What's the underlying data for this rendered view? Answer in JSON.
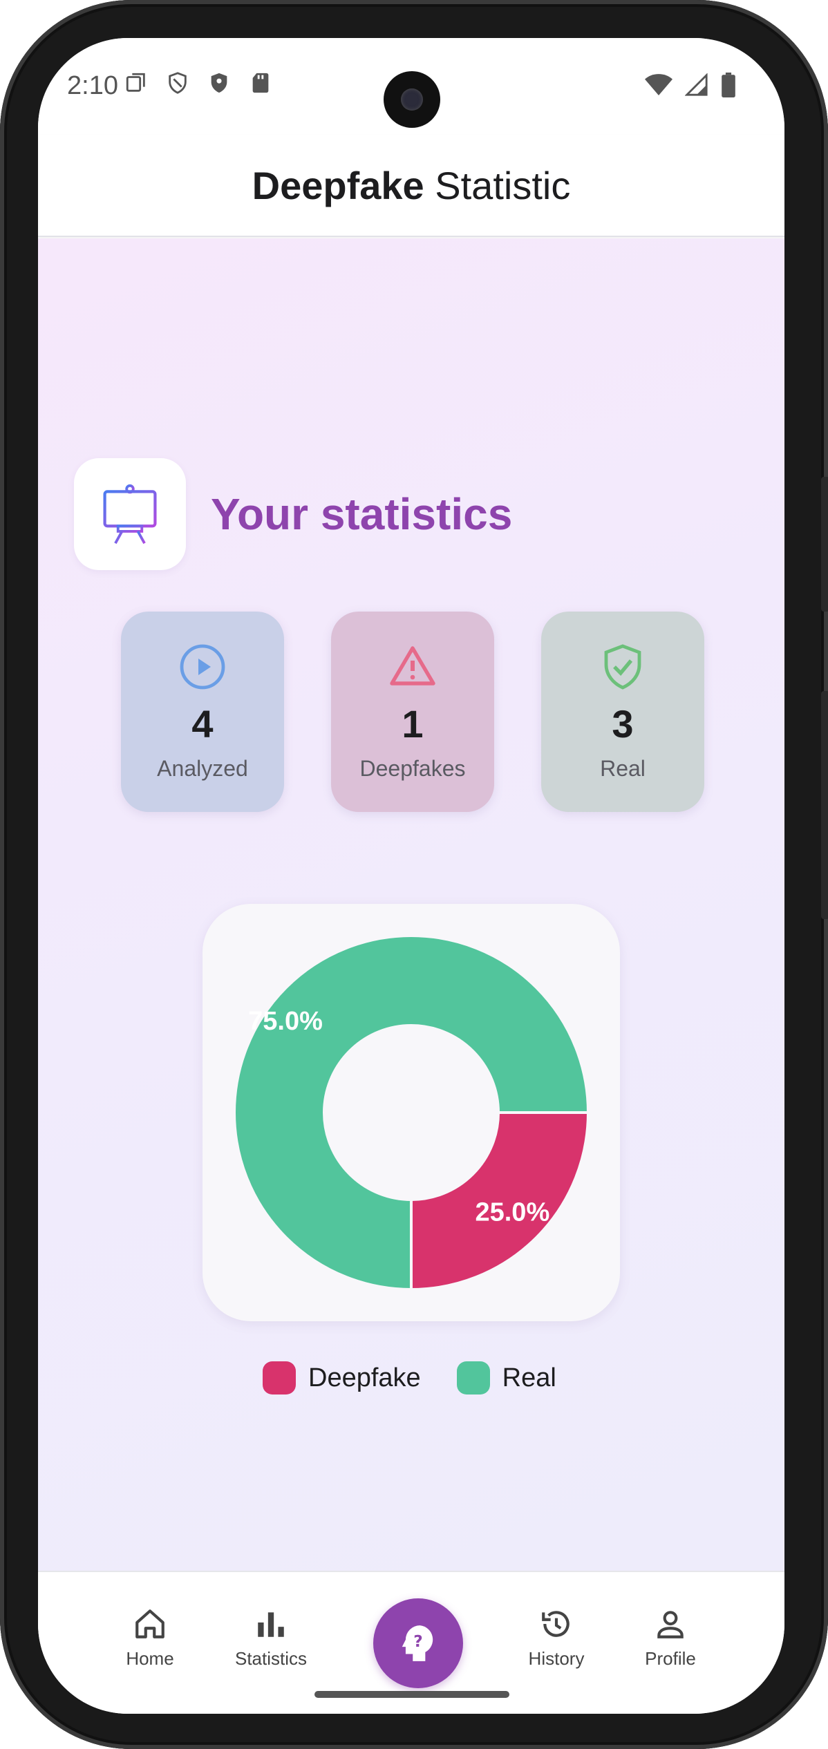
{
  "status_bar": {
    "time": "2:10"
  },
  "app_bar": {
    "title_bold": "Deepfake",
    "title_regular": "Statistic"
  },
  "header": {
    "title": "Your statistics",
    "icon": "presentation-board-icon"
  },
  "stats": [
    {
      "value": "4",
      "label": "Analyzed",
      "icon": "play-circle-icon",
      "color": "#6a9ee6"
    },
    {
      "value": "1",
      "label": "Deepfakes",
      "icon": "warning-triangle-icon",
      "color": "#e66a8a"
    },
    {
      "value": "3",
      "label": "Real",
      "icon": "shield-check-icon",
      "color": "#6cc07a"
    }
  ],
  "chart_data": {
    "type": "pie",
    "categories": [
      "Deepfake",
      "Real"
    ],
    "values": [
      25.0,
      75.0
    ],
    "labels": [
      "25.0%",
      "75.0%"
    ],
    "colors": [
      "#d8336c",
      "#52c59c"
    ],
    "donut": true
  },
  "legend": [
    {
      "label": "Deepfake",
      "color": "#d8336c"
    },
    {
      "label": "Real",
      "color": "#52c59c"
    }
  ],
  "bottom_nav": {
    "items": [
      {
        "label": "Home",
        "icon": "home-icon"
      },
      {
        "label": "Statistics",
        "icon": "bar-chart-icon"
      },
      {
        "label": "History",
        "icon": "history-icon"
      },
      {
        "label": "Profile",
        "icon": "person-icon"
      }
    ],
    "fab_icon": "question-head-icon",
    "accent": "#8e44ad"
  }
}
